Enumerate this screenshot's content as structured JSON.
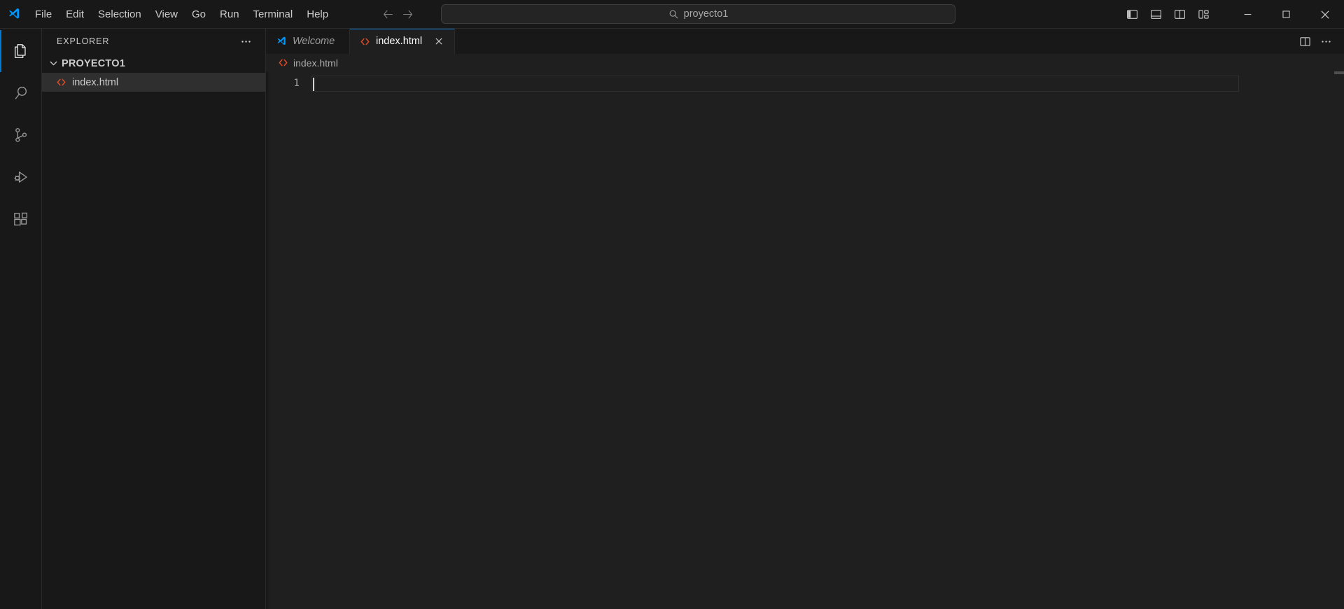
{
  "titlebar": {
    "logo_icon": "vscode-logo-icon",
    "menus": [
      {
        "label": "File"
      },
      {
        "label": "Edit"
      },
      {
        "label": "Selection"
      },
      {
        "label": "View"
      },
      {
        "label": "Go"
      },
      {
        "label": "Run"
      },
      {
        "label": "Terminal"
      },
      {
        "label": "Help"
      }
    ],
    "nav": {
      "back_icon": "arrow-left-icon",
      "forward_icon": "arrow-right-icon"
    },
    "command_center": {
      "search_icon": "search-icon",
      "value": "proyecto1",
      "placeholder": "Search"
    },
    "layout_buttons": [
      {
        "name": "toggle-primary-sidebar-button",
        "icon": "layout-sidebar-left-icon"
      },
      {
        "name": "toggle-panel-button",
        "icon": "layout-panel-bottom-icon"
      },
      {
        "name": "toggle-secondary-sidebar-button",
        "icon": "layout-sidebar-right-icon"
      },
      {
        "name": "customize-layout-button",
        "icon": "layout-customize-icon"
      }
    ],
    "window_controls": [
      {
        "name": "minimize-button",
        "icon": "minimize-icon",
        "label": "—"
      },
      {
        "name": "maximize-button",
        "icon": "maximize-icon",
        "label": "□"
      },
      {
        "name": "close-button",
        "icon": "close-icon",
        "label": "✕"
      }
    ]
  },
  "activitybar": {
    "items": [
      {
        "name": "activity-explorer",
        "icon": "files-icon",
        "label": "Explorer",
        "active": true
      },
      {
        "name": "activity-search",
        "icon": "search-icon",
        "label": "Search",
        "active": false
      },
      {
        "name": "activity-source-control",
        "icon": "source-control-icon",
        "label": "Source Control",
        "active": false
      },
      {
        "name": "activity-run-debug",
        "icon": "run-and-debug-icon",
        "label": "Run and Debug",
        "active": false
      },
      {
        "name": "activity-extensions",
        "icon": "extensions-icon",
        "label": "Extensions",
        "active": false
      }
    ]
  },
  "sidebar": {
    "title": "EXPLORER",
    "more_actions_icon": "ellipsis-icon",
    "tree": {
      "folder": {
        "label": "PROYECTO1",
        "expanded": true,
        "chevron_icon": "chevron-down-icon"
      },
      "files": [
        {
          "label": "index.html",
          "icon": "html-file-icon",
          "icon_color": "#e44d26",
          "selected": true
        }
      ]
    }
  },
  "editor": {
    "tabs": [
      {
        "name": "tab-welcome",
        "label": "Welcome",
        "icon": "vscode-logo-icon",
        "active": false,
        "italic": true,
        "closable": false
      },
      {
        "name": "tab-index-html",
        "label": "index.html",
        "icon": "html-file-icon",
        "active": true,
        "italic": false,
        "closable": true,
        "close_icon": "close-icon"
      }
    ],
    "tab_actions": [
      {
        "name": "split-editor-right-button",
        "icon": "split-editor-icon"
      },
      {
        "name": "more-editor-actions-button",
        "icon": "ellipsis-icon"
      }
    ],
    "breadcrumb": {
      "icon": "html-file-icon",
      "label": "index.html"
    },
    "content": {
      "lines": [
        {
          "number": "1",
          "text": ""
        }
      ],
      "cursor_line": 1,
      "cursor_column": 1
    }
  },
  "colors": {
    "accent": "#0078d4",
    "titlebar_bg": "#181818",
    "sidebar_bg": "#181818",
    "editor_bg": "#1f1f1f",
    "border": "#2b2b2b",
    "text": "#cccccc",
    "text_dim": "#9d9d9d",
    "html_orange": "#e44d26",
    "selection_bg": "#2f2f2f"
  }
}
